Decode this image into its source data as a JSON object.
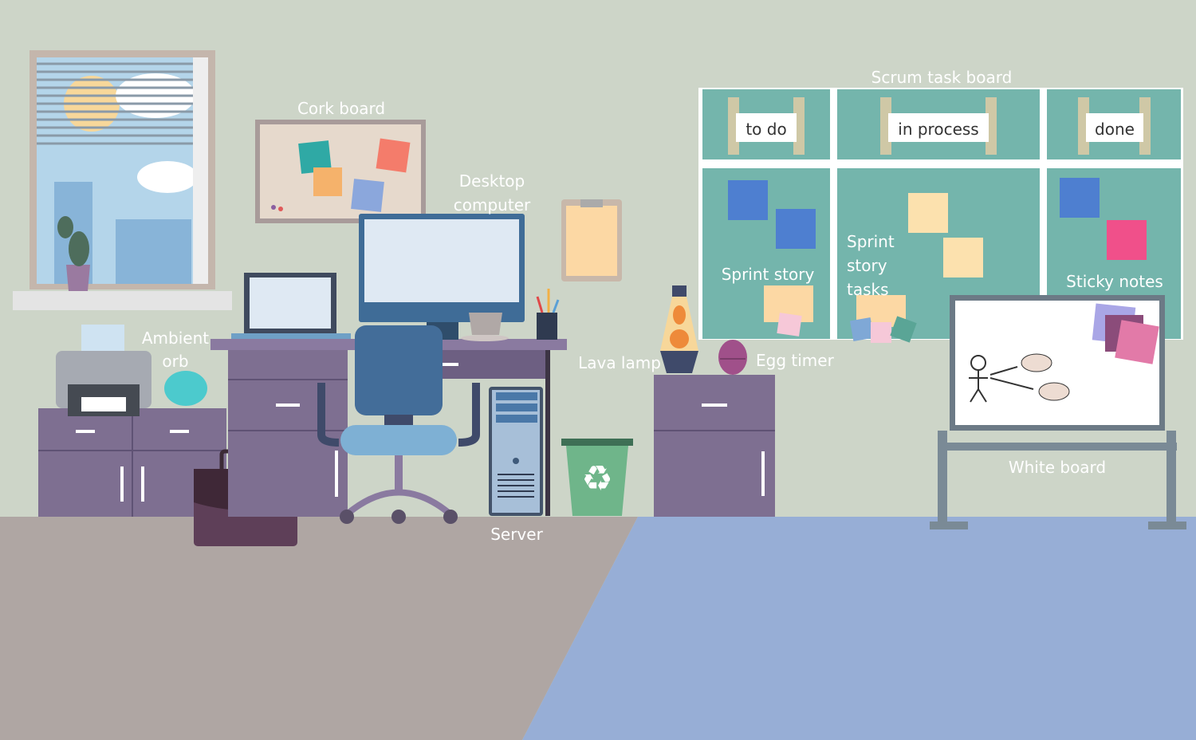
{
  "labels": {
    "cork_board": "Cork board",
    "desktop_line1": "Desktop",
    "desktop_line2": "computer",
    "scrum_board": "Scrum task board",
    "ambient_line1": "Ambient",
    "ambient_line2": "orb",
    "lava_lamp": "Lava lamp",
    "egg_timer": "Egg timer",
    "white_board": "White board",
    "server": "Server",
    "sprint_story": "Sprint story",
    "sprint_tasks_line1": "Sprint",
    "sprint_tasks_line2": "story",
    "sprint_tasks_line3": "tasks",
    "sticky_notes": "Sticky notes"
  },
  "scrum_columns": [
    "to do",
    "in process",
    "done"
  ],
  "colors": {
    "wall": "#cdd5c8",
    "floor_left": "#afa6a3",
    "floor_right": "#97aed6",
    "board": "#74b5ac",
    "furniture": "#7e6f91"
  }
}
